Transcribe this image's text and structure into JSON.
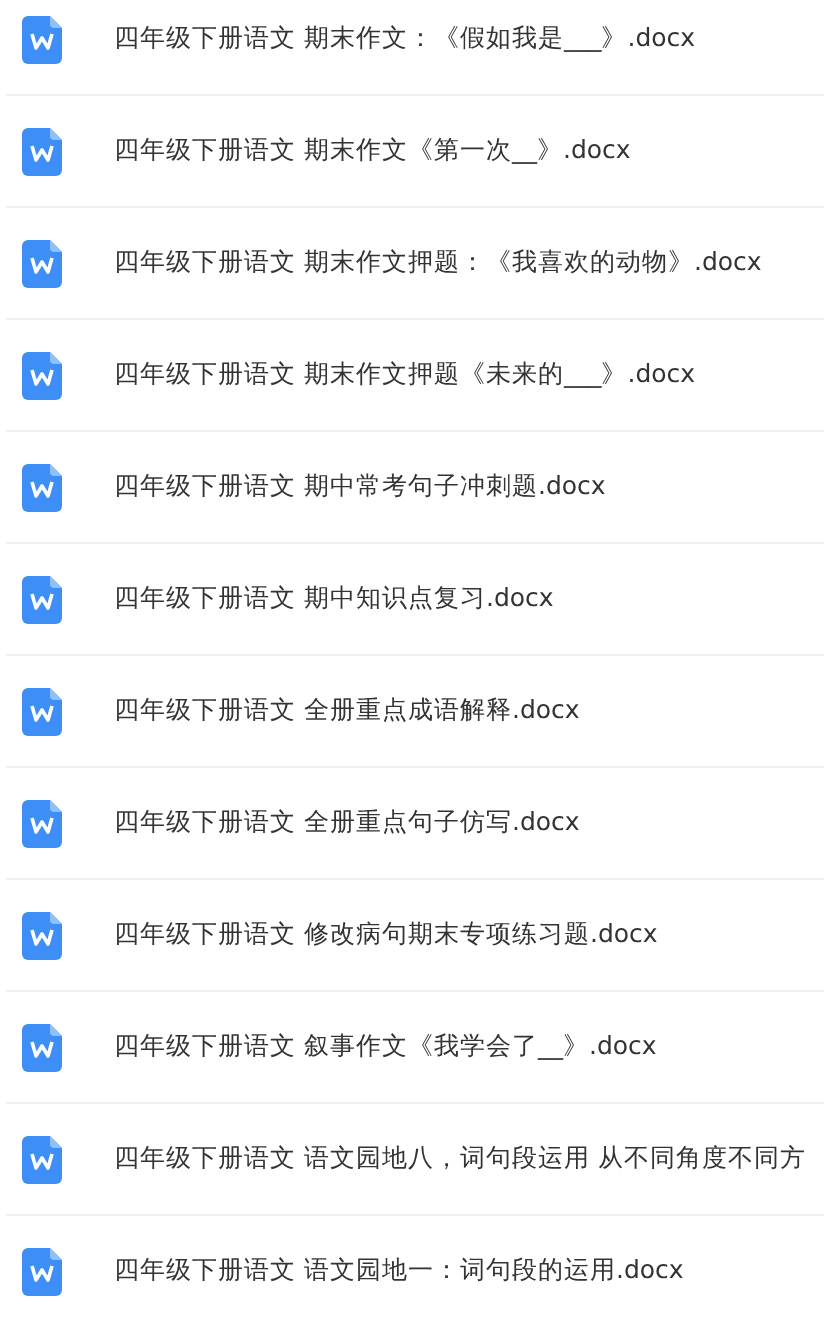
{
  "files": [
    {
      "name": "四年级下册语文 期末作文：《假如我是___》.docx"
    },
    {
      "name": "四年级下册语文 期末作文《第一次__》.docx"
    },
    {
      "name": "四年级下册语文 期末作文押题：《我喜欢的动物》.docx"
    },
    {
      "name": "四年级下册语文 期末作文押题《未来的___》.docx"
    },
    {
      "name": "四年级下册语文 期中常考句子冲刺题.docx"
    },
    {
      "name": "四年级下册语文 期中知识点复习.docx"
    },
    {
      "name": "四年级下册语文 全册重点成语解释.docx"
    },
    {
      "name": "四年级下册语文 全册重点句子仿写.docx"
    },
    {
      "name": "四年级下册语文 修改病句期末专项练习题.docx"
    },
    {
      "name": "四年级下册语文 叙事作文《我学会了__》.docx"
    },
    {
      "name": "四年级下册语文 语文园地八，词句段运用 从不同角度不同方"
    },
    {
      "name": "四年级下册语文 语文园地一：词句段的运用.docx"
    }
  ]
}
